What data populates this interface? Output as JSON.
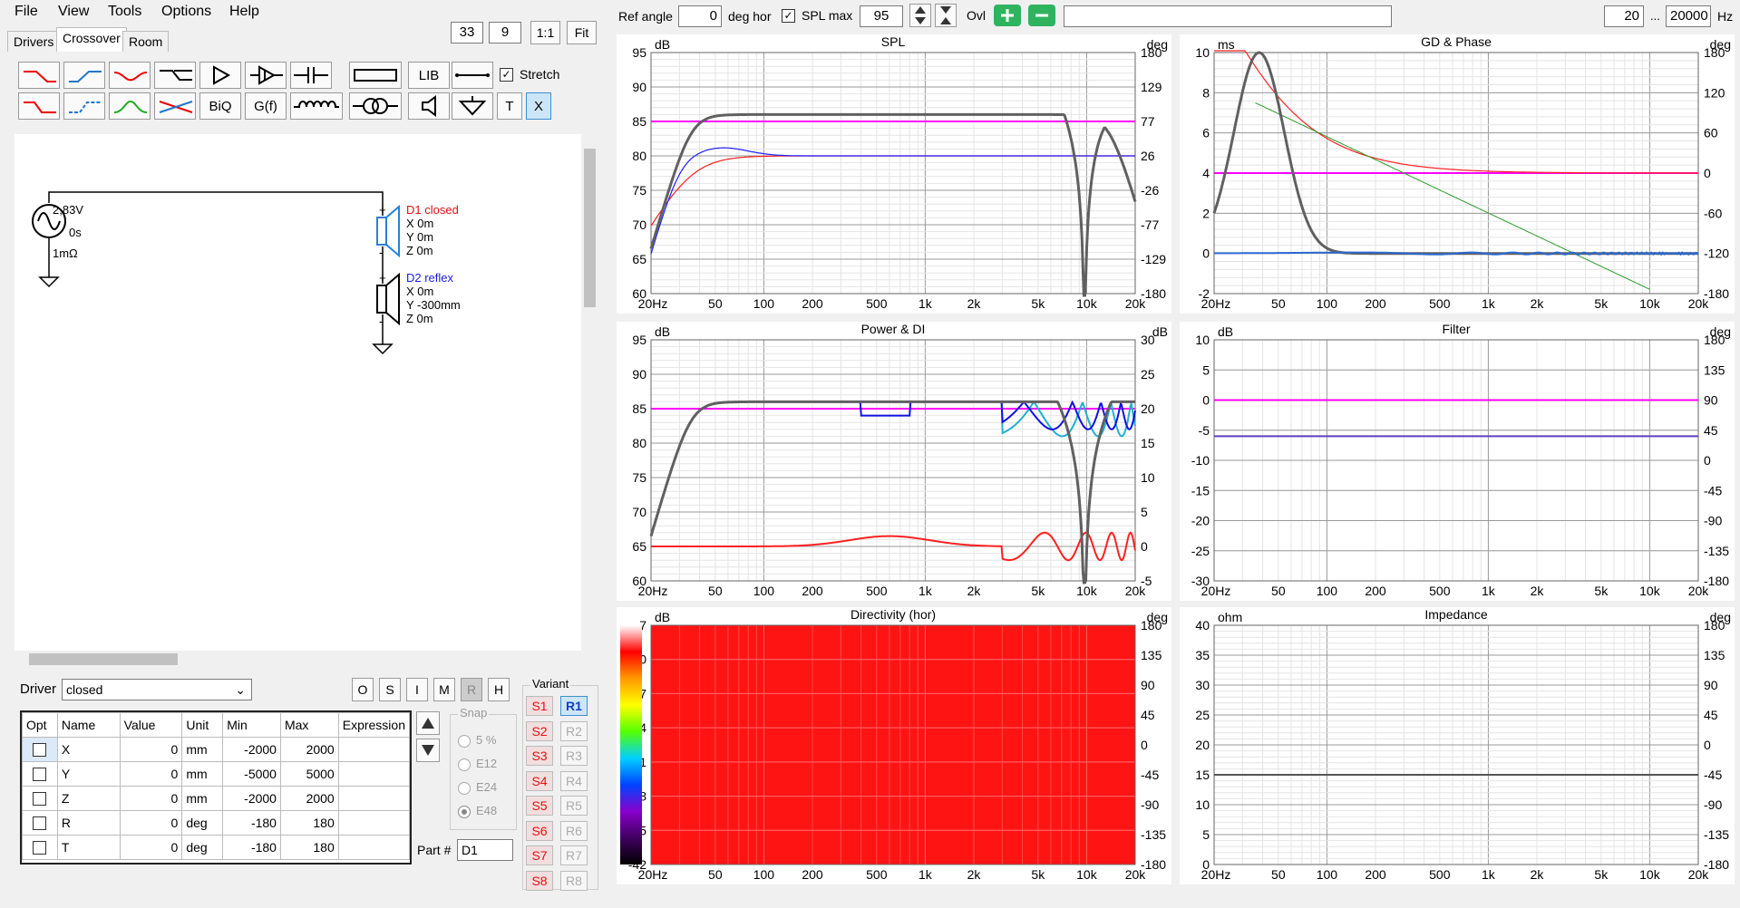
{
  "menu": [
    "File",
    "View",
    "Tools",
    "Options",
    "Help"
  ],
  "tabs": [
    "Drivers",
    "Crossover",
    "Room"
  ],
  "toolbar_right": {
    "v1": "33",
    "v2": "9",
    "b1": "1:1",
    "b2": "Fit"
  },
  "tools": {
    "lib": "LIB",
    "biq": "BiQ",
    "gf": "G(f)",
    "t": "T",
    "x": "X",
    "stretch": "Stretch"
  },
  "top": {
    "ref_angle_label": "Ref angle",
    "ref_angle": "0",
    "deg_hor": "deg hor",
    "spl_max_label": "SPL max",
    "spl_max": "95",
    "ovl": "Ovl",
    "fmin": "20",
    "dots": "...",
    "fmax": "20000",
    "hz": "Hz"
  },
  "schematic": {
    "voltage": "2,83V",
    "time": "0s",
    "res": "1mΩ",
    "d1": {
      "name": "D1 closed",
      "x": "X 0m",
      "y": "Y 0m",
      "z": "Z 0m"
    },
    "d2": {
      "name": "D2 reflex",
      "x": "X 0m",
      "y": "Y -300mm",
      "z": "Z 0m"
    }
  },
  "driver": {
    "label": "Driver",
    "value": "closed",
    "btns": [
      "O",
      "S",
      "I",
      "M",
      "R",
      "H"
    ]
  },
  "table": {
    "headers": [
      "Opt",
      "Name",
      "Value",
      "Unit",
      "Min",
      "Max",
      "Expression"
    ],
    "rows": [
      [
        "X",
        "0",
        "mm",
        "-2000",
        "2000"
      ],
      [
        "Y",
        "0",
        "mm",
        "-5000",
        "5000"
      ],
      [
        "Z",
        "0",
        "mm",
        "-2000",
        "2000"
      ],
      [
        "R",
        "0",
        "deg",
        "-180",
        "180"
      ],
      [
        "T",
        "0",
        "deg",
        "-180",
        "180"
      ]
    ]
  },
  "snap": {
    "label": "Snap",
    "opts": [
      "5 %",
      "E12",
      "E24",
      "E48"
    ]
  },
  "variant": {
    "label": "Variant",
    "s": [
      "S1",
      "S2",
      "S3",
      "S4",
      "S5",
      "S6",
      "S7",
      "S8"
    ],
    "r": [
      "R1",
      "R2",
      "R3",
      "R4",
      "R5",
      "R6",
      "R7",
      "R8"
    ]
  },
  "part": {
    "label": "Part #",
    "value": "D1"
  },
  "freq_ticks": [
    "20Hz",
    "50",
    "100",
    "200",
    "500",
    "1k",
    "2k",
    "5k",
    "10k",
    "20k"
  ],
  "plots": {
    "spl": {
      "title": "SPL",
      "lunit": "dB",
      "runit": "deg",
      "left": [
        "95",
        "90",
        "85",
        "80",
        "75",
        "70",
        "65",
        "60"
      ],
      "right": [
        "180",
        "129",
        "77",
        "26",
        "-26",
        "-77",
        "-129",
        "-180"
      ]
    },
    "gd": {
      "title": "GD & Phase",
      "lunit": "ms",
      "runit": "deg",
      "left": [
        "10",
        "8",
        "6",
        "4",
        "2",
        "0",
        "-2"
      ],
      "right": [
        "180",
        "120",
        "60",
        "0",
        "-60",
        "-120",
        "-180"
      ]
    },
    "power": {
      "title": "Power & DI",
      "lunit": "dB",
      "runit": "dB",
      "left": [
        "95",
        "90",
        "85",
        "80",
        "75",
        "70",
        "65",
        "60"
      ],
      "right": [
        "30",
        "25",
        "20",
        "15",
        "10",
        "5",
        "0",
        "-5"
      ]
    },
    "filter": {
      "title": "Filter",
      "lunit": "dB",
      "runit": "deg",
      "left": [
        "10",
        "5",
        "0",
        "-5",
        "-10",
        "-15",
        "-20",
        "-25",
        "-30"
      ],
      "right": [
        "180",
        "135",
        "90",
        "45",
        "0",
        "-45",
        "-90",
        "-135",
        "-180"
      ]
    },
    "dir": {
      "title": "Directivity (hor)",
      "lunit": "dB",
      "runit": "deg",
      "left": [
        "7",
        "0",
        "-7",
        "-14",
        "-21",
        "-28",
        "-35",
        "-42"
      ],
      "right": [
        "180",
        "135",
        "90",
        "45",
        "0",
        "-45",
        "-90",
        "-135",
        "-180"
      ]
    },
    "imp": {
      "title": "Impedance",
      "lunit": "ohm",
      "runit": "deg",
      "left": [
        "40",
        "35",
        "30",
        "25",
        "20",
        "15",
        "10",
        "5",
        "0"
      ],
      "right": [
        "180",
        "135",
        "90",
        "45",
        "0",
        "-45",
        "-90",
        "-135",
        "-180"
      ]
    }
  },
  "colors": {
    "accent": "#ff00ff",
    "driver1": "#ff2020",
    "driver2": "#2020ff",
    "sum": "#606060",
    "dir_fill": "#ff1414"
  }
}
